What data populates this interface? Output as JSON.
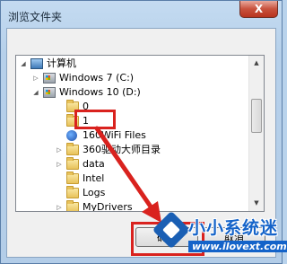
{
  "window": {
    "title": "浏览文件夹",
    "close_label": "X"
  },
  "tree": {
    "items": [
      {
        "label": "计算机",
        "icon": "computer-icon",
        "expanded": true
      },
      {
        "label": "Windows 7 (C:)",
        "icon": "drive-icon",
        "expanded": false
      },
      {
        "label": "Windows 10 (D:)",
        "icon": "drive-icon",
        "expanded": true
      },
      {
        "label": "0",
        "icon": "folder-icon"
      },
      {
        "label": "1",
        "icon": "folder-icon"
      },
      {
        "label": "160WiFi Files",
        "icon": "globe-icon"
      },
      {
        "label": "360驱动大师目录",
        "icon": "folder-icon"
      },
      {
        "label": "data",
        "icon": "folder-icon"
      },
      {
        "label": "Intel",
        "icon": "folder-icon"
      },
      {
        "label": "Logs",
        "icon": "folder-icon"
      },
      {
        "label": "MyDrivers",
        "icon": "folder-icon"
      }
    ]
  },
  "buttons": {
    "ok": "确定",
    "cancel": "取消"
  },
  "watermark": {
    "title": "小小系统迷",
    "url": "www.ilovext.com"
  },
  "colors": {
    "annotation_red": "#d9221e",
    "brand_blue": "#1463c9"
  }
}
